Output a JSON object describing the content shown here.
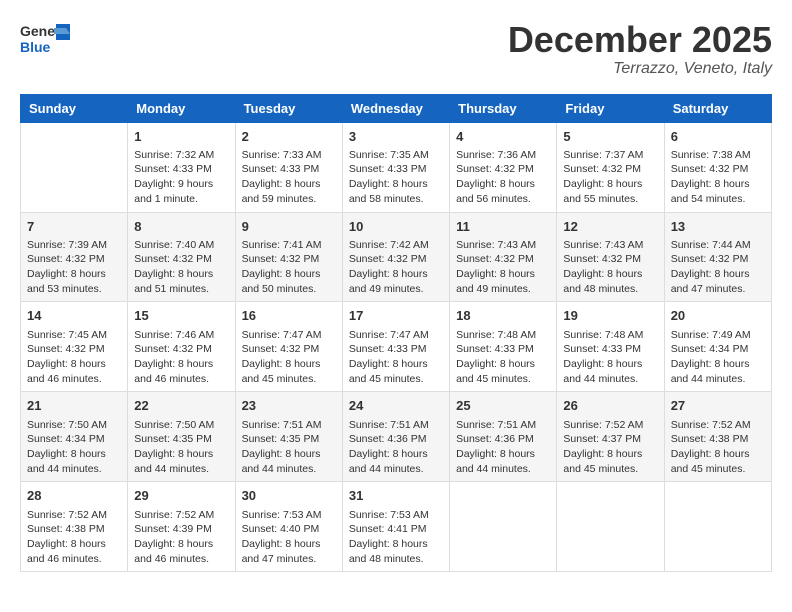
{
  "header": {
    "logo": {
      "general": "General",
      "blue": "Blue"
    },
    "title": "December 2025",
    "location": "Terrazzo, Veneto, Italy"
  },
  "days_of_week": [
    "Sunday",
    "Monday",
    "Tuesday",
    "Wednesday",
    "Thursday",
    "Friday",
    "Saturday"
  ],
  "weeks": [
    [
      {
        "day": "",
        "info": ""
      },
      {
        "day": "1",
        "info": "Sunrise: 7:32 AM\nSunset: 4:33 PM\nDaylight: 9 hours\nand 1 minute."
      },
      {
        "day": "2",
        "info": "Sunrise: 7:33 AM\nSunset: 4:33 PM\nDaylight: 8 hours\nand 59 minutes."
      },
      {
        "day": "3",
        "info": "Sunrise: 7:35 AM\nSunset: 4:33 PM\nDaylight: 8 hours\nand 58 minutes."
      },
      {
        "day": "4",
        "info": "Sunrise: 7:36 AM\nSunset: 4:32 PM\nDaylight: 8 hours\nand 56 minutes."
      },
      {
        "day": "5",
        "info": "Sunrise: 7:37 AM\nSunset: 4:32 PM\nDaylight: 8 hours\nand 55 minutes."
      },
      {
        "day": "6",
        "info": "Sunrise: 7:38 AM\nSunset: 4:32 PM\nDaylight: 8 hours\nand 54 minutes."
      }
    ],
    [
      {
        "day": "7",
        "info": "Sunrise: 7:39 AM\nSunset: 4:32 PM\nDaylight: 8 hours\nand 53 minutes."
      },
      {
        "day": "8",
        "info": "Sunrise: 7:40 AM\nSunset: 4:32 PM\nDaylight: 8 hours\nand 51 minutes."
      },
      {
        "day": "9",
        "info": "Sunrise: 7:41 AM\nSunset: 4:32 PM\nDaylight: 8 hours\nand 50 minutes."
      },
      {
        "day": "10",
        "info": "Sunrise: 7:42 AM\nSunset: 4:32 PM\nDaylight: 8 hours\nand 49 minutes."
      },
      {
        "day": "11",
        "info": "Sunrise: 7:43 AM\nSunset: 4:32 PM\nDaylight: 8 hours\nand 49 minutes."
      },
      {
        "day": "12",
        "info": "Sunrise: 7:43 AM\nSunset: 4:32 PM\nDaylight: 8 hours\nand 48 minutes."
      },
      {
        "day": "13",
        "info": "Sunrise: 7:44 AM\nSunset: 4:32 PM\nDaylight: 8 hours\nand 47 minutes."
      }
    ],
    [
      {
        "day": "14",
        "info": "Sunrise: 7:45 AM\nSunset: 4:32 PM\nDaylight: 8 hours\nand 46 minutes."
      },
      {
        "day": "15",
        "info": "Sunrise: 7:46 AM\nSunset: 4:32 PM\nDaylight: 8 hours\nand 46 minutes."
      },
      {
        "day": "16",
        "info": "Sunrise: 7:47 AM\nSunset: 4:32 PM\nDaylight: 8 hours\nand 45 minutes."
      },
      {
        "day": "17",
        "info": "Sunrise: 7:47 AM\nSunset: 4:33 PM\nDaylight: 8 hours\nand 45 minutes."
      },
      {
        "day": "18",
        "info": "Sunrise: 7:48 AM\nSunset: 4:33 PM\nDaylight: 8 hours\nand 45 minutes."
      },
      {
        "day": "19",
        "info": "Sunrise: 7:48 AM\nSunset: 4:33 PM\nDaylight: 8 hours\nand 44 minutes."
      },
      {
        "day": "20",
        "info": "Sunrise: 7:49 AM\nSunset: 4:34 PM\nDaylight: 8 hours\nand 44 minutes."
      }
    ],
    [
      {
        "day": "21",
        "info": "Sunrise: 7:50 AM\nSunset: 4:34 PM\nDaylight: 8 hours\nand 44 minutes."
      },
      {
        "day": "22",
        "info": "Sunrise: 7:50 AM\nSunset: 4:35 PM\nDaylight: 8 hours\nand 44 minutes."
      },
      {
        "day": "23",
        "info": "Sunrise: 7:51 AM\nSunset: 4:35 PM\nDaylight: 8 hours\nand 44 minutes."
      },
      {
        "day": "24",
        "info": "Sunrise: 7:51 AM\nSunset: 4:36 PM\nDaylight: 8 hours\nand 44 minutes."
      },
      {
        "day": "25",
        "info": "Sunrise: 7:51 AM\nSunset: 4:36 PM\nDaylight: 8 hours\nand 44 minutes."
      },
      {
        "day": "26",
        "info": "Sunrise: 7:52 AM\nSunset: 4:37 PM\nDaylight: 8 hours\nand 45 minutes."
      },
      {
        "day": "27",
        "info": "Sunrise: 7:52 AM\nSunset: 4:38 PM\nDaylight: 8 hours\nand 45 minutes."
      }
    ],
    [
      {
        "day": "28",
        "info": "Sunrise: 7:52 AM\nSunset: 4:38 PM\nDaylight: 8 hours\nand 46 minutes."
      },
      {
        "day": "29",
        "info": "Sunrise: 7:52 AM\nSunset: 4:39 PM\nDaylight: 8 hours\nand 46 minutes."
      },
      {
        "day": "30",
        "info": "Sunrise: 7:53 AM\nSunset: 4:40 PM\nDaylight: 8 hours\nand 47 minutes."
      },
      {
        "day": "31",
        "info": "Sunrise: 7:53 AM\nSunset: 4:41 PM\nDaylight: 8 hours\nand 48 minutes."
      },
      {
        "day": "",
        "info": ""
      },
      {
        "day": "",
        "info": ""
      },
      {
        "day": "",
        "info": ""
      }
    ]
  ]
}
